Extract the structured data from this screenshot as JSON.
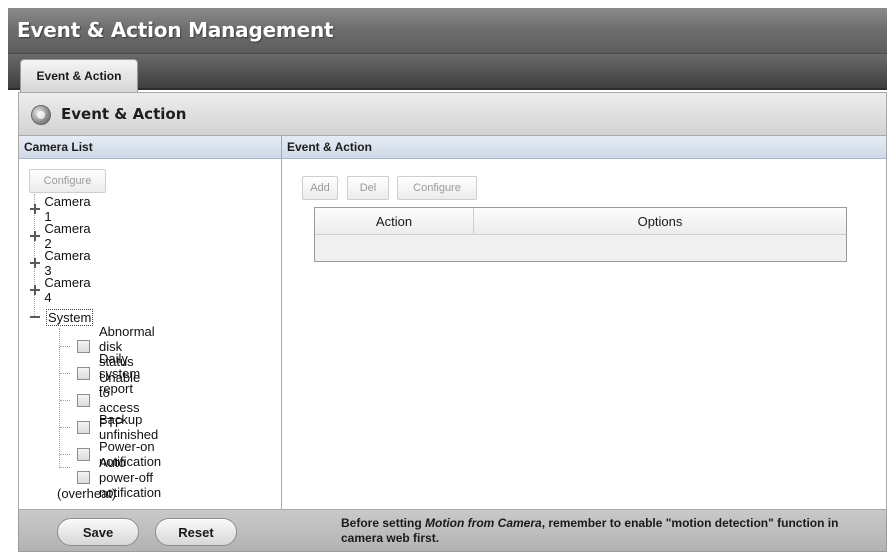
{
  "window": {
    "title": "Event & Action Management"
  },
  "tabs": [
    {
      "label": "Event & Action"
    }
  ],
  "section": {
    "title": "Event & Action"
  },
  "camera_list": {
    "header": "Camera List",
    "configure_button": "Configure",
    "nodes": [
      {
        "label": "Camera 1"
      },
      {
        "label": "Camera 2"
      },
      {
        "label": "Camera 3"
      },
      {
        "label": "Camera 4"
      },
      {
        "label": "System"
      }
    ],
    "system_children": [
      {
        "label": "Abnormal disk status"
      },
      {
        "label": "Daily system report"
      },
      {
        "label": "Unable to access FTP"
      },
      {
        "label": "Backup unfinished"
      },
      {
        "label": "Power-on notification"
      },
      {
        "label": "Auto power-off notification"
      }
    ],
    "overheat_note": "(overheat)"
  },
  "event_action": {
    "header": "Event & Action",
    "buttons": {
      "add": "Add",
      "del": "Del",
      "configure": "Configure"
    },
    "columns": [
      "Action",
      "Options"
    ]
  },
  "footer": {
    "save": "Save",
    "reset": "Reset",
    "note_prefix": "Before setting ",
    "note_emphasis": "Motion from Camera",
    "note_suffix": ", remember to enable \"motion detection\" function in camera web first."
  }
}
